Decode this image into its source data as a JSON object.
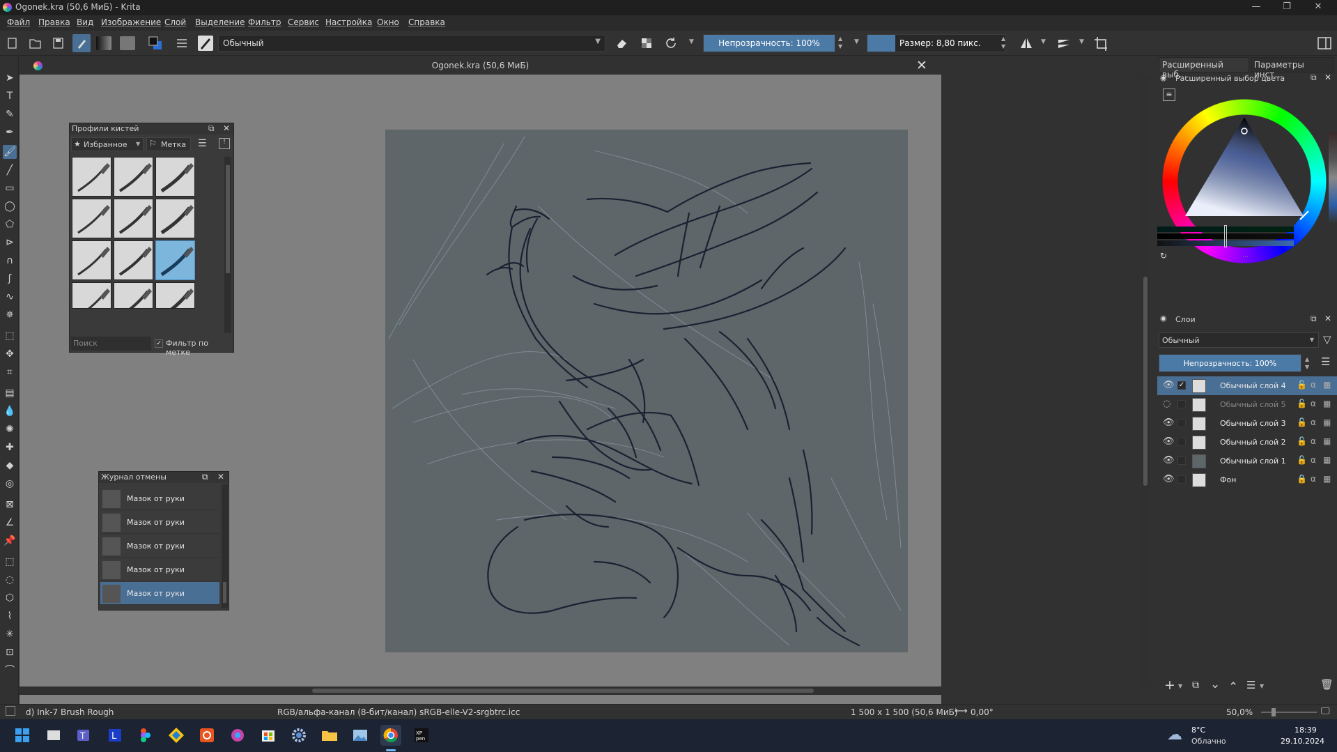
{
  "window": {
    "title": "Ogonek.kra (50,6 МиБ) - Krita",
    "minimize": "—",
    "maximize": "❐",
    "close": "✕"
  },
  "menu": [
    "Файл",
    "Правка",
    "Вид",
    "Изображение",
    "Слой",
    "Выделение",
    "Фильтр",
    "Сервис",
    "Настройка",
    "Окно",
    "Справка"
  ],
  "toolbar": {
    "blend_mode": "Обычный",
    "opacity_label": "Непрозрачность: 100%",
    "opacity_value": 1.0,
    "size_label": "Размер: 8,80 пикс.",
    "size_value": 8.8
  },
  "document": {
    "title": "Ogonek.kra (50,6 МиБ)"
  },
  "brush_presets": {
    "title": "Профили кистей",
    "tag": "Избранное",
    "label_button": "Метка",
    "search_placeholder": "Поиск",
    "filter_label": "Фильтр по метке",
    "filter_checked": true,
    "selected_index": 8
  },
  "undo_history": {
    "title": "Журнал отмены",
    "items": [
      "Мазок от руки",
      "Мазок от руки",
      "Мазок от руки",
      "Мазок от руки",
      "Мазок от руки"
    ],
    "selected_index": 4
  },
  "right_tabs": [
    "Расширенный выб...",
    "Параметры инст..."
  ],
  "color_selector": {
    "title": "Расширенный выбор цвета"
  },
  "layers": {
    "title": "Слои",
    "blend_mode": "Обычный",
    "opacity_label": "Непрозрачность:  100%",
    "items": [
      {
        "name": "Обычный слой 4",
        "visible": true,
        "selected": true,
        "locked": false
      },
      {
        "name": "Обычный слой 5",
        "visible": false,
        "selected": false,
        "locked": false
      },
      {
        "name": "Обычный слой 3",
        "visible": true,
        "selected": false,
        "locked": false
      },
      {
        "name": "Обычный слой 2",
        "visible": true,
        "selected": false,
        "locked": false
      },
      {
        "name": "Обычный слой 1",
        "visible": true,
        "selected": false,
        "locked": false
      },
      {
        "name": "Фон",
        "visible": true,
        "selected": false,
        "locked": true
      }
    ]
  },
  "status": {
    "brush": "d) Ink-7 Brush Rough",
    "color_space": "RGB/альфа-канал (8-бит/канал)  sRGB-elle-V2-srgbtrc.icc",
    "dimensions": "1 500 x 1 500 (50,6 МиБ)",
    "rotation": "0,00°",
    "zoom": "50,0%"
  },
  "taskbar": {
    "weather_temp": "8°C",
    "weather_desc": "Облачно",
    "time": "18:39",
    "date": "29.10.2024"
  },
  "colors": {
    "accent": "#4a6f95",
    "canvas_bg": "#808080",
    "page_bg": "#5e666a",
    "ink": "#1a2232"
  }
}
